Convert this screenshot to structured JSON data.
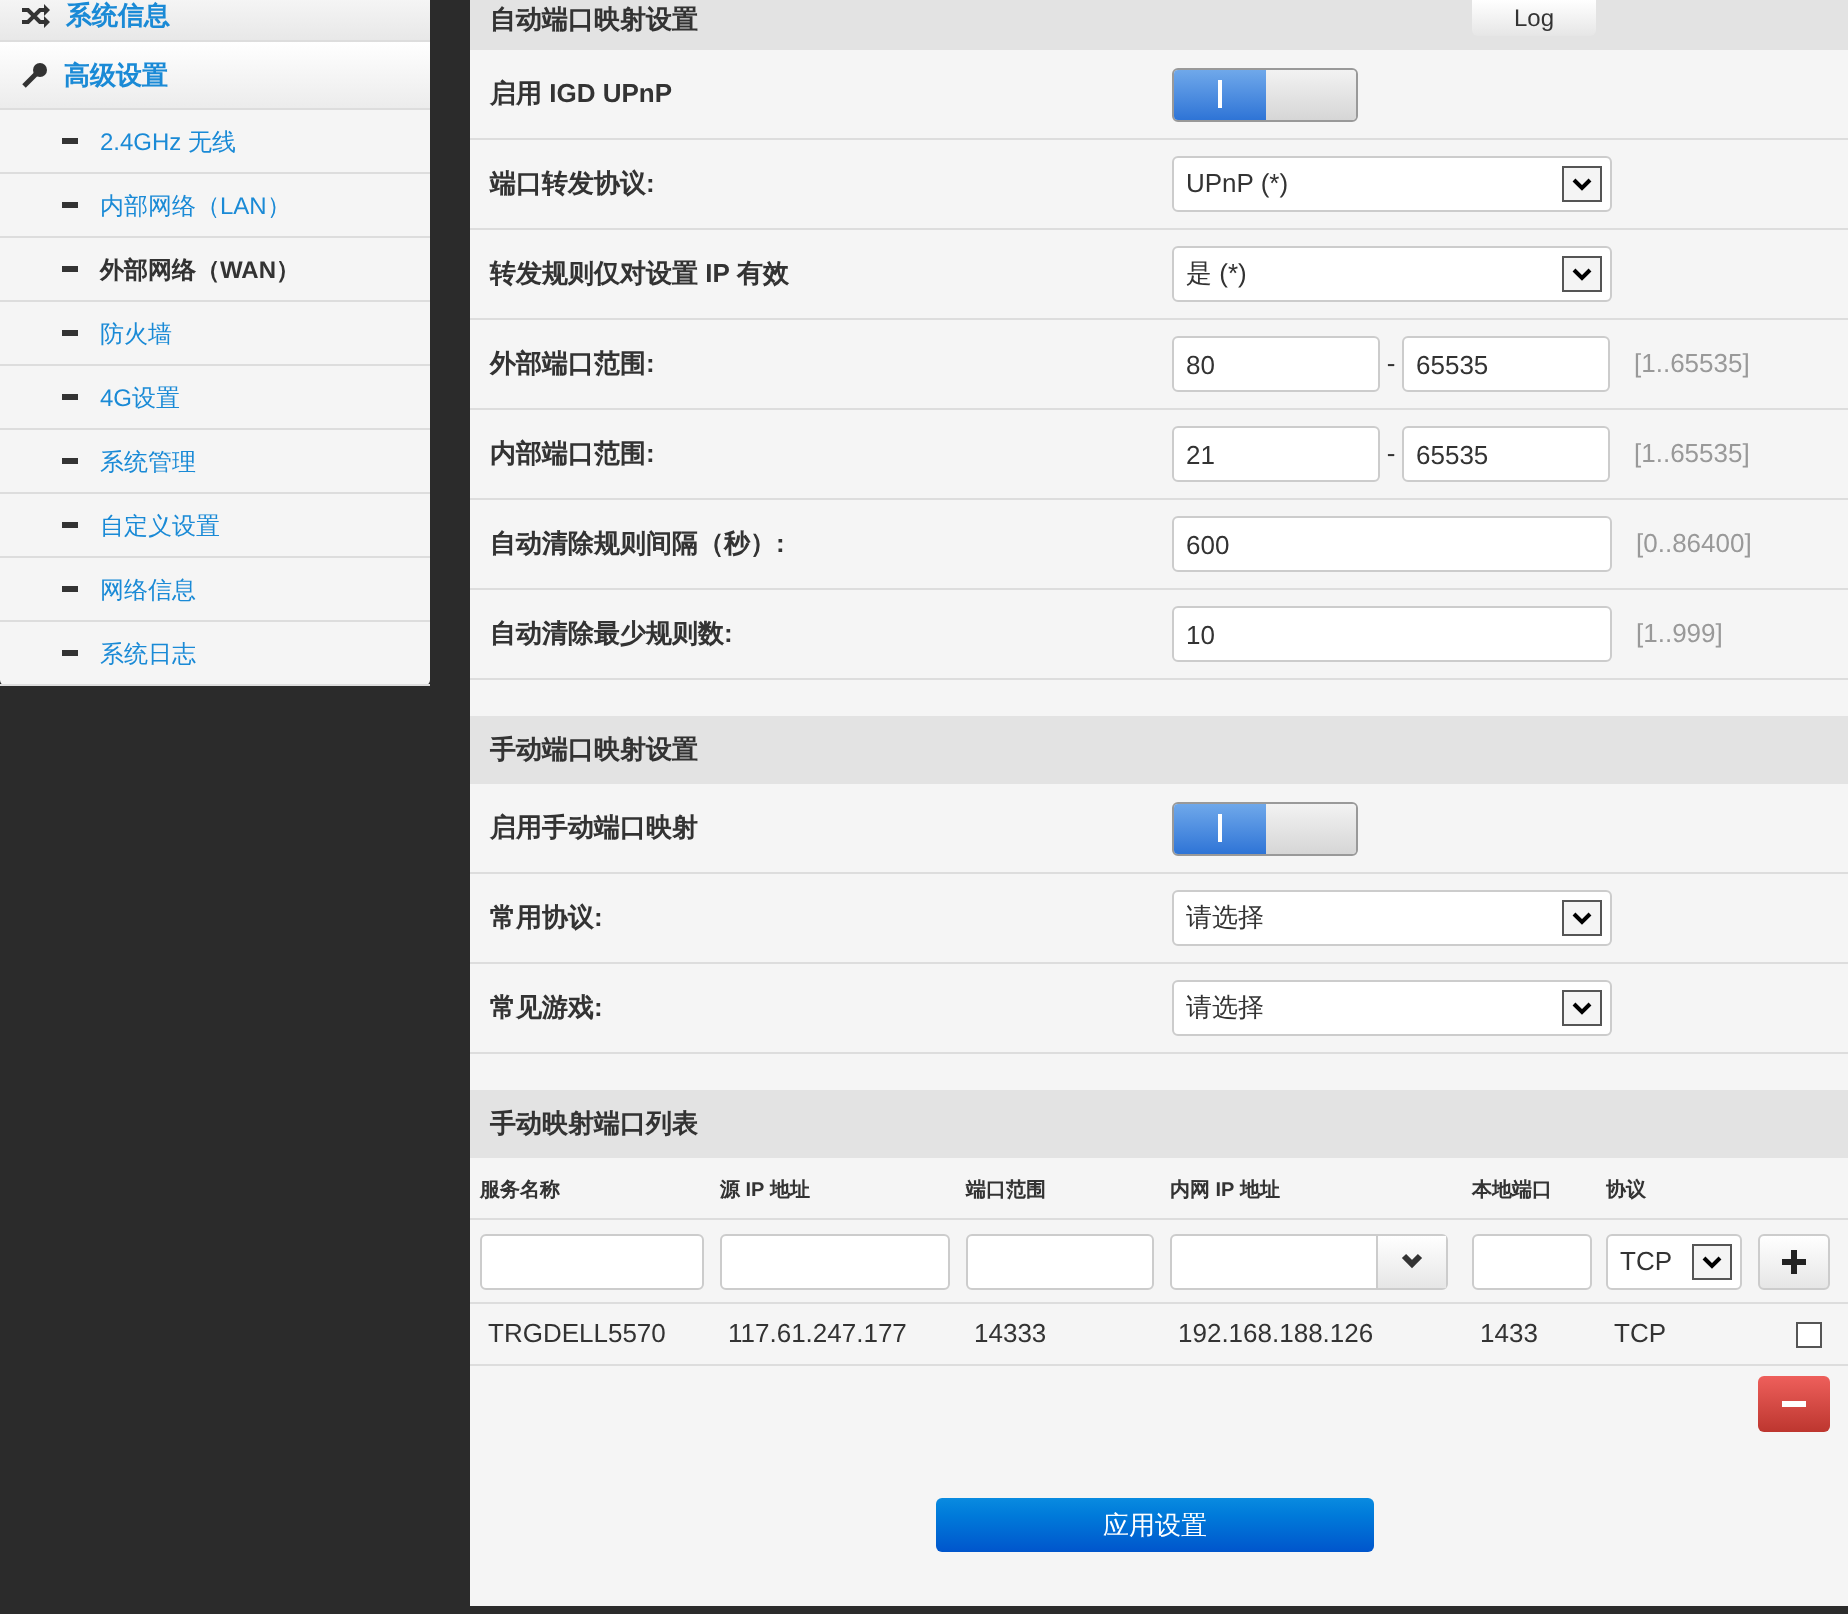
{
  "sidebar": {
    "sections": [
      {
        "label": "系统信息"
      },
      {
        "label": "高级设置",
        "children": [
          {
            "label": "2.4GHz 无线",
            "selected": false
          },
          {
            "label": "内部网络（LAN）",
            "selected": false
          },
          {
            "label": "外部网络（WAN）",
            "selected": true
          },
          {
            "label": "防火墙",
            "selected": false
          },
          {
            "label": "4G设置",
            "selected": false
          },
          {
            "label": "系统管理",
            "selected": false
          },
          {
            "label": "自定义设置",
            "selected": false
          },
          {
            "label": "网络信息",
            "selected": false
          },
          {
            "label": "系统日志",
            "selected": false
          }
        ]
      }
    ]
  },
  "auto_mapping": {
    "title": "自动端口映射设置",
    "log_button": "Log",
    "rows": [
      {
        "kind": "toggle",
        "label": "启用 IGD UPnP",
        "on": true
      },
      {
        "kind": "select",
        "label": "端口转发协议:",
        "value": "UPnP (*)"
      },
      {
        "kind": "select",
        "label": "转发规则仅对设置 IP 有效",
        "value": "是 (*)"
      },
      {
        "kind": "range",
        "label": "外部端口范围:",
        "from": "80",
        "separator": "-",
        "to": "65535",
        "hint": "[1..65535]"
      },
      {
        "kind": "range",
        "label": "内部端口范围:",
        "from": "21",
        "separator": "-",
        "to": "65535",
        "hint": "[1..65535]"
      },
      {
        "kind": "input",
        "label": "自动清除规则间隔（秒）:",
        "value": "600",
        "hint": "[0..86400]"
      },
      {
        "kind": "input",
        "label": "自动清除最少规则数:",
        "value": "10",
        "hint": "[1..999]"
      }
    ]
  },
  "manual_mapping": {
    "title": "手动端口映射设置",
    "rows": [
      {
        "kind": "toggle",
        "label": "启用手动端口映射",
        "on": true
      },
      {
        "kind": "select",
        "label": "常用协议:",
        "value": "请选择"
      },
      {
        "kind": "select",
        "label": "常见游戏:",
        "value": "请选择"
      }
    ]
  },
  "port_list": {
    "title": "手动映射端口列表",
    "columns": [
      "服务名称",
      "源 IP 地址",
      "端口范围",
      "内网 IP 地址",
      "本地端口",
      "协议"
    ],
    "new_row": {
      "protocol": "TCP"
    },
    "rows": [
      {
        "cells": [
          "TRGDELL5570",
          "117.61.247.177",
          "14333",
          "192.168.188.126",
          "1433",
          "TCP"
        ],
        "checked": false
      }
    ]
  },
  "apply_button": "应用设置"
}
